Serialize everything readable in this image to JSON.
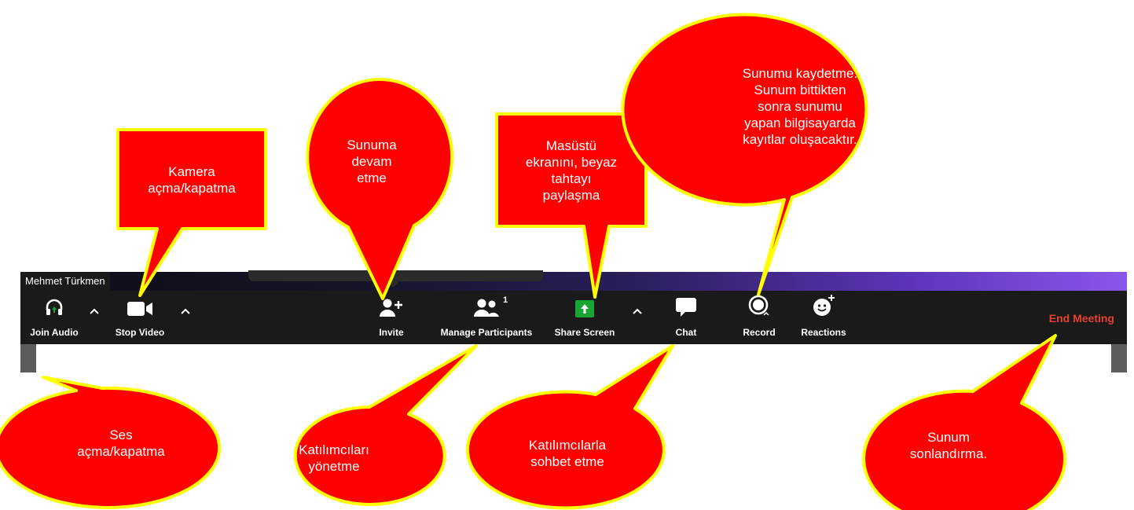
{
  "meeting": {
    "participant_name": "Mehmet Türkmen",
    "end_meeting_label": "End Meeting",
    "accent_colors": {
      "toolbar_bg": "#1a1a1a",
      "share_green": "#19a532",
      "end_red": "#e8402e"
    },
    "toolbar": {
      "join_audio": {
        "label": "Join Audio",
        "icon": "headphones-icon"
      },
      "stop_video": {
        "label": "Stop Video",
        "icon": "video-camera-icon"
      },
      "invite": {
        "label": "Invite",
        "icon": "add-user-icon"
      },
      "manage_participants": {
        "label": "Manage Participants",
        "icon": "participants-icon",
        "count": "1"
      },
      "share_screen": {
        "label": "Share Screen",
        "icon": "share-arrow-icon"
      },
      "chat": {
        "label": "Chat",
        "icon": "chat-bubble-icon"
      },
      "record": {
        "label": "Record",
        "icon": "record-icon"
      },
      "reactions": {
        "label": "Reactions",
        "icon": "emoji-plus-icon"
      }
    }
  },
  "callouts": {
    "camera": "Kamera\naçma/kapatma",
    "continue": "Sunuma\ndevam\netme",
    "share": "Masüstü\nekranını, beyaz\ntahtayı\npaylaşma",
    "record": "Sunumu kaydetme.\nSunum bittikten\nsonra sunumu\nyapan bilgisayarda\nkayıtlar oluşacaktır.",
    "audio": "Ses\naçma/kapatma",
    "participants": "Katılımcıları\nyönetme",
    "chat": "Katılımcılarla\nsohbet etme",
    "end": "Sunum\nsonlandırma.",
    "colors": {
      "fill": "#ff0000",
      "border": "#ffff00"
    }
  }
}
